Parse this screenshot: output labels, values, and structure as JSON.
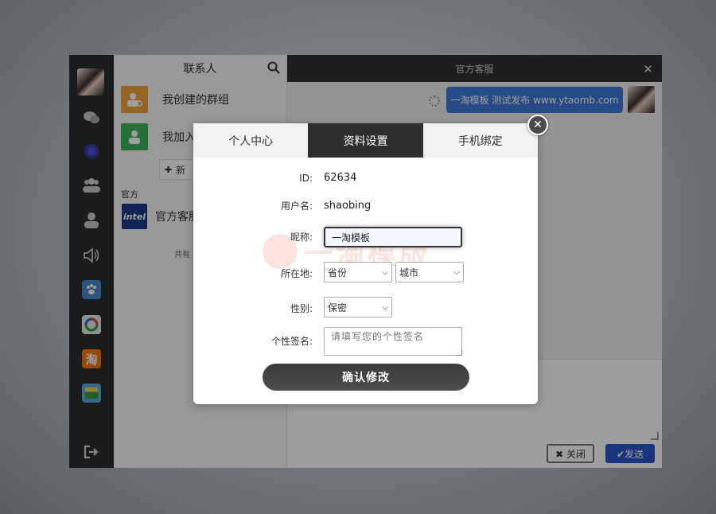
{
  "sidebar": {
    "icons": [
      "chat-bubbles-icon",
      "globe-icon",
      "group-icon",
      "user-icon",
      "speaker-icon",
      "paw-icon",
      "circle-logo-icon",
      "taobao-icon",
      "app-icon",
      "logout-icon"
    ],
    "taobao_glyph": "淘"
  },
  "contacts": {
    "title": "联系人",
    "groups": [
      {
        "label": "我创建的群组",
        "color": "#f0a23a"
      },
      {
        "label": "我加入",
        "color": "#3cb55e"
      }
    ],
    "new_button": "新",
    "section_official": "官方",
    "official_item": "官方客服",
    "official_logo_text": "intel",
    "count_text": "共有"
  },
  "chat": {
    "title": "官方客服",
    "close_glyph": "✕",
    "message": "一淘模板 测试发布 www.ytaomb.com",
    "close_button": "✖ 关闭",
    "send_button": "✔发送"
  },
  "modal": {
    "tabs": [
      "个人中心",
      "资料设置",
      "手机绑定"
    ],
    "active_tab": 1,
    "close_glyph": "✕",
    "fields": {
      "id_label": "ID:",
      "id_value": "62634",
      "username_label": "用户名:",
      "username_value": "shaobing",
      "nickname_label": "昵称:",
      "nickname_value": "一淘模板",
      "location_label": "所在地:",
      "province_value": "省份",
      "city_value": "城市",
      "gender_label": "性别:",
      "gender_value": "保密",
      "signature_label": "个性签名:",
      "signature_placeholder": "请填写您的个性签名"
    },
    "confirm_button": "确认修改",
    "watermark": "一淘模版"
  },
  "colors": {
    "active_tab": "#2e2e2e",
    "send_button": "#2b56c9",
    "message_bubble": "#3c78d8",
    "chat_header": "#2f3035"
  }
}
